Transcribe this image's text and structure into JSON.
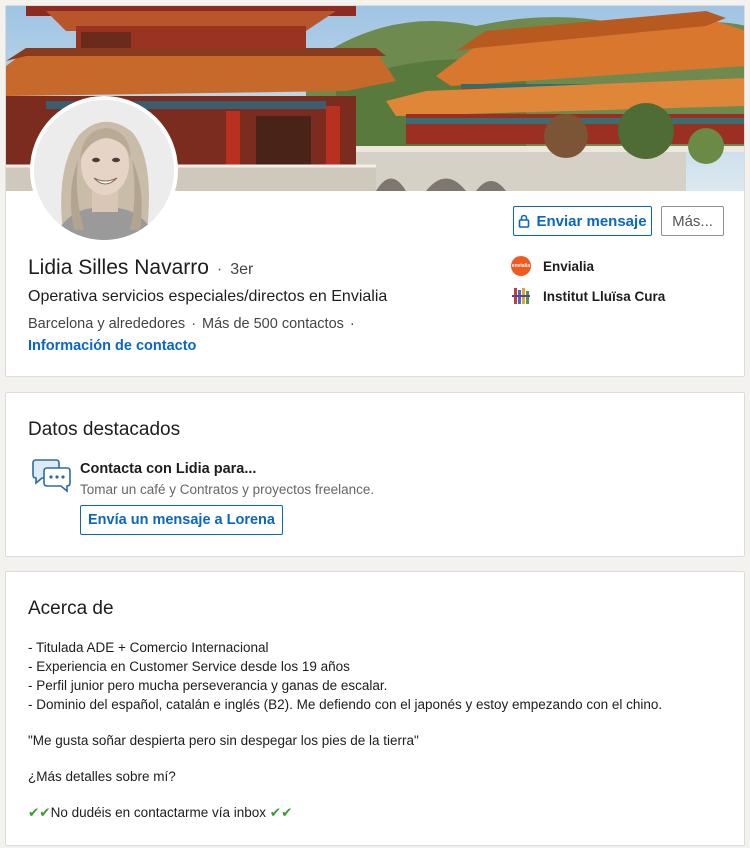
{
  "profile": {
    "name": "Lidia Silles Navarro",
    "degree": "3er",
    "headline": "Operativa servicios especiales/directos en Envialia",
    "location": "Barcelona y alrededores",
    "connections": "Más de 500 contactos",
    "contact_info_link": "Información de contacto",
    "actions": {
      "send_message": "Enviar mensaje",
      "more": "Más..."
    },
    "organizations": [
      {
        "name": "Envialia",
        "logo_text": "envialia"
      },
      {
        "name": "Institut Lluïsa Cura"
      }
    ]
  },
  "featured": {
    "title": "Datos destacados",
    "card_title": "Contacta con Lidia para...",
    "card_subtitle": "Tomar un café y Contratos y proyectos freelance.",
    "button_label": "Envía un mensaje a Lorena"
  },
  "about": {
    "title": "Acerca de",
    "lines": [
      "- Titulada ADE + Comercio Internacional",
      "- Experiencia en Customer Service desde los 19 años",
      "- Perfil junior pero mucha perseverancia y ganas de escalar.",
      "- Dominio del español, catalán e inglés (B2). Me defiendo con el japonés y estoy empezando con el chino."
    ],
    "quote": "\"Me gusta soñar despierta pero sin despegar los pies de la tierra\"",
    "more_details": "¿Más detalles sobre mí?",
    "closing_checks_left": "✔✔",
    "closing_text": "No dudéis en contactarme vía inbox",
    "closing_checks_right": "✔✔"
  },
  "colors": {
    "link_blue": "#0a66c2",
    "envialia_orange": "#f05a1f",
    "check_green": "#3a9a36"
  }
}
